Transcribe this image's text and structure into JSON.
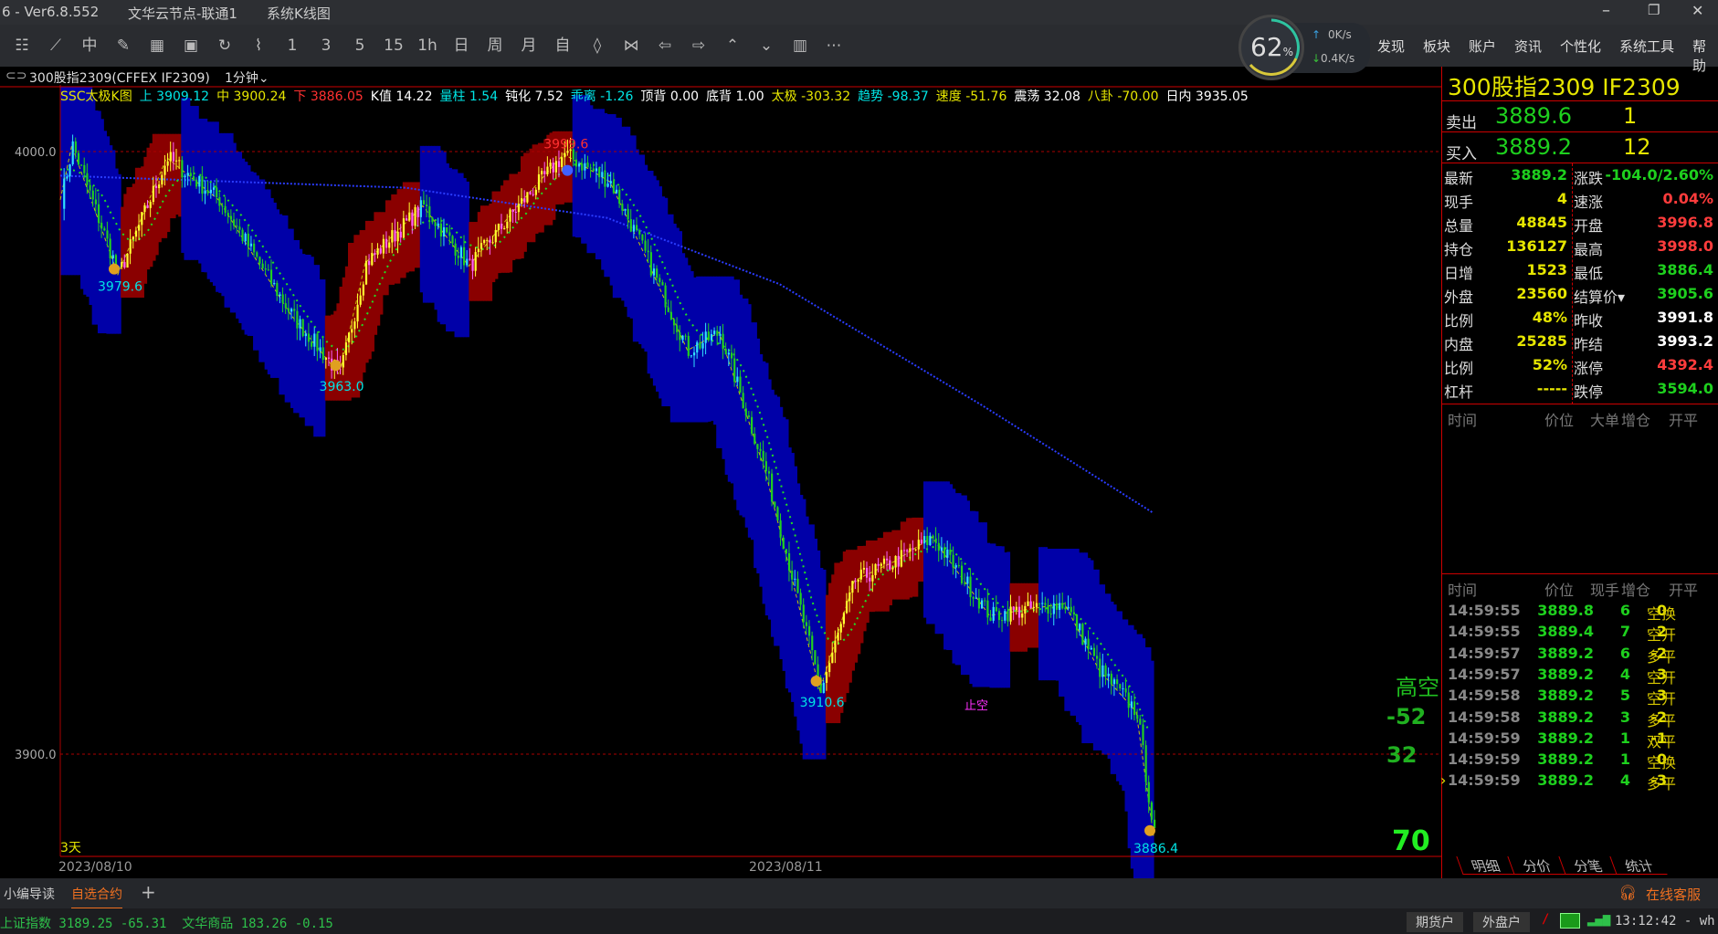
{
  "titlebar": {
    "version": "6  -  Ver6.8.552",
    "node": "文华云节点-联通1",
    "view": "系统K线图"
  },
  "toolbar": {
    "periods": [
      "1",
      "3",
      "5",
      "15",
      "1h",
      "日",
      "周",
      "月",
      "自"
    ],
    "menu": [
      "发现",
      "板块",
      "账户",
      "资讯",
      "个性化",
      "系统工具",
      "帮助"
    ],
    "gauge": "62",
    "gauge_unit": "%",
    "up_speed": "0K/s",
    "down_speed": "0.4K/s"
  },
  "chart_head": {
    "contract": "300股指2309(CFFEX IF2309)",
    "period": "1分钟"
  },
  "indicators": [
    {
      "t": "SSC太极K图",
      "c": "#e6e600"
    },
    {
      "t": "上 3909.12",
      "c": "#00e5e5"
    },
    {
      "t": "中 3900.24",
      "c": "#e6e600"
    },
    {
      "t": "下 3886.05",
      "c": "#ff3030"
    },
    {
      "t": "K值 14.22",
      "c": "#ffffff"
    },
    {
      "t": "量柱 1.54",
      "c": "#00e5e5"
    },
    {
      "t": "钝化 7.52",
      "c": "#ffffff"
    },
    {
      "t": "乖离 -1.26",
      "c": "#00e5e5"
    },
    {
      "t": "顶背 0.00",
      "c": "#ffffff"
    },
    {
      "t": "底背 1.00",
      "c": "#ffffff"
    },
    {
      "t": "太极 -303.32",
      "c": "#e6e600"
    },
    {
      "t": "趋势 -98.37",
      "c": "#00e5e5"
    },
    {
      "t": "速度 -51.76",
      "c": "#e6e600"
    },
    {
      "t": "震荡 32.08",
      "c": "#ffffff"
    },
    {
      "t": "八卦 -70.00",
      "c": "#e6e600"
    },
    {
      "t": "日内 3935.05",
      "c": "#ffffff"
    }
  ],
  "chart_data": {
    "type": "candlestick",
    "ylim": [
      3880,
      4005
    ],
    "yticks": [
      "4000.0",
      "3900.0"
    ],
    "xlabels": [
      {
        "i": 0,
        "t": "2023/08/10"
      },
      {
        "i": 240,
        "t": "2023/08/11"
      }
    ],
    "bars": 480,
    "path": [
      [
        0,
        3992
      ],
      [
        4,
        4001
      ],
      [
        20,
        3979.6
      ],
      [
        37,
        3999
      ],
      [
        55,
        3992
      ],
      [
        80,
        3973
      ],
      [
        97,
        3963.0
      ],
      [
        106,
        3981.5
      ],
      [
        126,
        3991
      ],
      [
        142,
        3981
      ],
      [
        159,
        3991
      ],
      [
        175,
        3999.6
      ],
      [
        191,
        3995
      ],
      [
        203,
        3983
      ],
      [
        218,
        3967
      ],
      [
        229,
        3970
      ],
      [
        245,
        3947
      ],
      [
        264,
        3910.6
      ],
      [
        276,
        3928.8
      ],
      [
        290,
        3932
      ],
      [
        303,
        3936
      ],
      [
        323,
        3923
      ],
      [
        349,
        3925
      ],
      [
        361,
        3914
      ],
      [
        374,
        3907
      ],
      [
        380,
        3886.4
      ]
    ],
    "ma": [
      [
        0,
        3996
      ],
      [
        120,
        3994
      ],
      [
        190,
        3989
      ],
      [
        250,
        3978
      ],
      [
        320,
        3958
      ],
      [
        380,
        3940
      ]
    ],
    "labels": [
      {
        "i": 20,
        "v": "3979.6",
        "c": "#00e5e5",
        "pos": "below"
      },
      {
        "i": 97,
        "v": "3963.0",
        "c": "#00e5e5",
        "pos": "below"
      },
      {
        "i": 175,
        "v": "3999.6",
        "c": "#ff3030",
        "pos": "above"
      },
      {
        "i": 264,
        "v": "3910.6",
        "c": "#00e5e5",
        "pos": "below"
      },
      {
        "i": 380,
        "v": "3886.4",
        "c": "#00e5e5",
        "pos": "below"
      }
    ],
    "signals": {
      "label": "高空",
      "v1": "-52",
      "v2": "32",
      "v3": "70",
      "bottom_tag": "3天",
      "sub_tag": "止空"
    }
  },
  "panel": {
    "title": "300股指2309  IF2309",
    "sell": {
      "label": "卖出",
      "price": "3889.6",
      "vol": "1"
    },
    "buy": {
      "label": "买入",
      "price": "3889.2",
      "vol": "12"
    },
    "stats": [
      {
        "a": "最新",
        "b": "3889.2",
        "bc": "#1ed01e",
        "c": "涨跌",
        "d": "-104.0/2.60%",
        "dc": "#1ed01e"
      },
      {
        "a": "现手",
        "b": "4",
        "bc": "#e6e600",
        "c": "速涨",
        "d": "0.04%",
        "dc": "#ff3c3c"
      },
      {
        "a": "总量",
        "b": "48845",
        "bc": "#e6e600",
        "c": "开盘",
        "d": "3996.8",
        "dc": "#ff3c3c"
      },
      {
        "a": "持仓",
        "b": "136127",
        "bc": "#e6e600",
        "c": "最高",
        "d": "3998.0",
        "dc": "#ff3c3c"
      },
      {
        "a": "日增",
        "b": "1523",
        "bc": "#e6e600",
        "c": "最低",
        "d": "3886.4",
        "dc": "#1ed01e"
      },
      {
        "a": "外盘",
        "b": "23560",
        "bc": "#e6e600",
        "c": "结算价▾",
        "d": "3905.6",
        "dc": "#1ed01e"
      },
      {
        "a": "比例",
        "b": "48%",
        "bc": "#e6e600",
        "c": "昨收",
        "d": "3991.8",
        "dc": "#ffffff"
      },
      {
        "a": "内盘",
        "b": "25285",
        "bc": "#e6e600",
        "c": "昨结",
        "d": "3993.2",
        "dc": "#ffffff"
      },
      {
        "a": "比例",
        "b": "52%",
        "bc": "#e6e600",
        "c": "涨停",
        "d": "4392.4",
        "dc": "#ff3c3c"
      },
      {
        "a": "杠杆",
        "b": "-----",
        "bc": "#e6e600",
        "c": "跌停",
        "d": "3594.0",
        "dc": "#1ed01e"
      }
    ],
    "big_head": [
      "时间",
      "价位",
      "大单",
      "增仓",
      "开平"
    ],
    "tick_head": [
      "时间",
      "价位",
      "现手",
      "增仓",
      "开平"
    ],
    "ticks": [
      [
        "14:59:55",
        "3889.8",
        "6",
        "0",
        "空换"
      ],
      [
        "14:59:55",
        "3889.4",
        "7",
        "2",
        "空开"
      ],
      [
        "14:59:57",
        "3889.2",
        "6",
        "-2",
        "多平"
      ],
      [
        "14:59:57",
        "3889.2",
        "4",
        "3",
        "空开"
      ],
      [
        "14:59:58",
        "3889.2",
        "5",
        "3",
        "空开"
      ],
      [
        "14:59:58",
        "3889.2",
        "3",
        "-2",
        "多平"
      ],
      [
        "14:59:59",
        "3889.2",
        "1",
        "-1",
        "双平"
      ],
      [
        "14:59:59",
        "3889.2",
        "1",
        "0",
        "空换"
      ],
      [
        "14:59:59",
        "3889.2",
        "4",
        "-3",
        "多平"
      ]
    ],
    "tabs": [
      "明细",
      "分价",
      "分笔",
      "统计"
    ]
  },
  "bottom": {
    "tabs": [
      "小编导读",
      "自选合约"
    ],
    "add": "+",
    "service": "在线客服",
    "ticker": "上证指数 3189.25 -65.31  文华商品 183.26 -0.15",
    "acct1": "期货户",
    "acct2": "外盘户",
    "clock": "13:12:42 - wh"
  }
}
